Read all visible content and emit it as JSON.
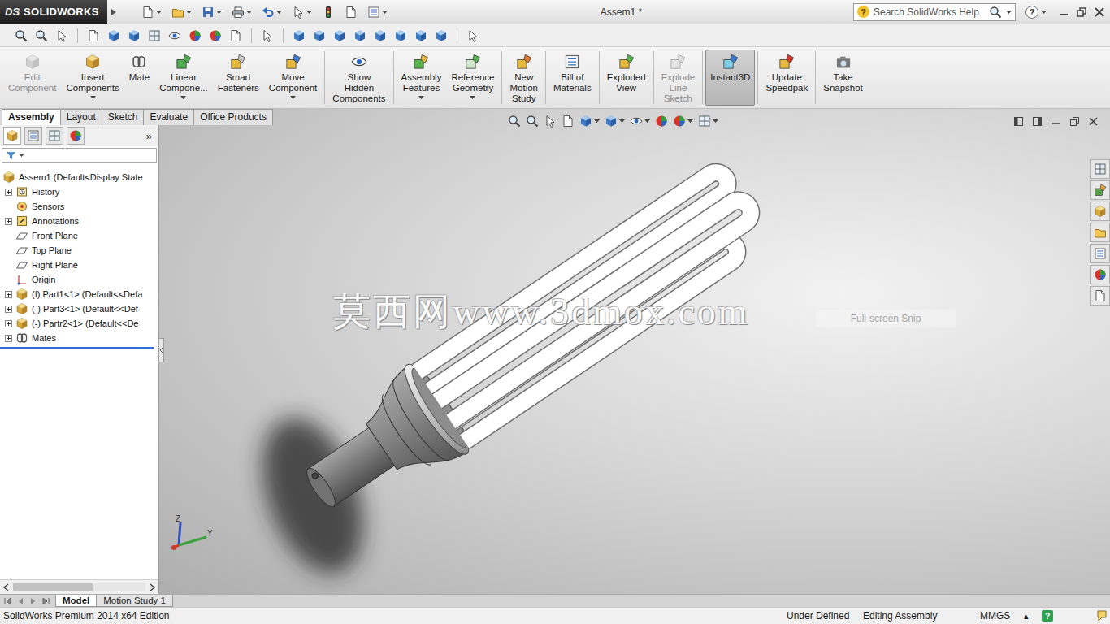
{
  "window": {
    "logo_mark": "DS",
    "logo_name": "SOLIDWORKS",
    "title": "Assem1 *",
    "help": "?"
  },
  "search": {
    "placeholder": "Search SolidWorks Help",
    "icon": "?"
  },
  "ribbon": [
    {
      "lines": [
        "Edit",
        "Component"
      ],
      "disabled": true,
      "selected": false,
      "dropdown": false
    },
    {
      "lines": [
        "Insert",
        "Components"
      ],
      "disabled": false,
      "selected": false,
      "dropdown": true
    },
    {
      "lines": [
        "Mate"
      ],
      "disabled": false,
      "selected": false,
      "dropdown": false
    },
    {
      "lines": [
        "Linear",
        "Compone..."
      ],
      "disabled": false,
      "selected": false,
      "dropdown": true
    },
    {
      "lines": [
        "Smart",
        "Fasteners"
      ],
      "disabled": false,
      "selected": false,
      "dropdown": false
    },
    {
      "lines": [
        "Move",
        "Component"
      ],
      "disabled": false,
      "selected": false,
      "dropdown": true
    },
    {
      "lines": [
        "Show",
        "Hidden",
        "Components"
      ],
      "disabled": false,
      "selected": false,
      "dropdown": false
    },
    {
      "lines": [
        "Assembly",
        "Features"
      ],
      "disabled": false,
      "selected": false,
      "dropdown": true
    },
    {
      "lines": [
        "Reference",
        "Geometry"
      ],
      "disabled": false,
      "selected": false,
      "dropdown": true
    },
    {
      "lines": [
        "New",
        "Motion",
        "Study"
      ],
      "disabled": false,
      "selected": false,
      "dropdown": false
    },
    {
      "lines": [
        "Bill of",
        "Materials"
      ],
      "disabled": false,
      "selected": false,
      "dropdown": false
    },
    {
      "lines": [
        "Exploded",
        "View"
      ],
      "disabled": false,
      "selected": false,
      "dropdown": false
    },
    {
      "lines": [
        "Explode",
        "Line",
        "Sketch"
      ],
      "disabled": true,
      "selected": false,
      "dropdown": false
    },
    {
      "lines": [
        "Instant3D"
      ],
      "disabled": false,
      "selected": true,
      "dropdown": false
    },
    {
      "lines": [
        "Update",
        "Speedpak"
      ],
      "disabled": false,
      "selected": false,
      "dropdown": false
    },
    {
      "lines": [
        "Take",
        "Snapshot"
      ],
      "disabled": false,
      "selected": false,
      "dropdown": false
    }
  ],
  "command_tabs": [
    {
      "label": "Assembly",
      "selected": true
    },
    {
      "label": "Layout",
      "selected": false
    },
    {
      "label": "Sketch",
      "selected": false
    },
    {
      "label": "Evaluate",
      "selected": false
    },
    {
      "label": "Office Products",
      "selected": false
    }
  ],
  "sidebar": {
    "more": "»",
    "items": [
      {
        "label": "Assem1  (Default<Display State",
        "expandable": false,
        "kind": "assembly"
      },
      {
        "label": "History",
        "expandable": true,
        "kind": "history"
      },
      {
        "label": "Sensors",
        "expandable": false,
        "kind": "sensor"
      },
      {
        "label": "Annotations",
        "expandable": true,
        "kind": "annotation"
      },
      {
        "label": "Front Plane",
        "expandable": false,
        "kind": "plane"
      },
      {
        "label": "Top Plane",
        "expandable": false,
        "kind": "plane"
      },
      {
        "label": "Right Plane",
        "expandable": false,
        "kind": "plane"
      },
      {
        "label": "Origin",
        "expandable": false,
        "kind": "origin"
      },
      {
        "label": "(f) Part1<1> (Default<<Defa",
        "expandable": true,
        "kind": "part"
      },
      {
        "label": "(-) Part3<1> (Default<<Def",
        "expandable": true,
        "kind": "part"
      },
      {
        "label": "(-) Partr2<1> (Default<<De",
        "expandable": true,
        "kind": "part"
      },
      {
        "label": "Mates",
        "expandable": true,
        "kind": "mates"
      }
    ],
    "scrollbar": {
      "level": 0.6
    }
  },
  "viewport": {
    "watermark": "莫西网www.3dmox.com",
    "snip_label": "Full-screen Snip",
    "triad": {
      "z": "Z",
      "y": "Y"
    }
  },
  "bottom_tabs": [
    {
      "label": "Model",
      "selected": true
    },
    {
      "label": "Motion Study 1",
      "selected": false
    }
  ],
  "status_bar": {
    "edition": "SolidWorks Premium 2014 x64 Edition",
    "state": "Under Defined",
    "mode": "Editing Assembly",
    "units": "MMGS",
    "units_arrow": "▴",
    "help": "?"
  }
}
